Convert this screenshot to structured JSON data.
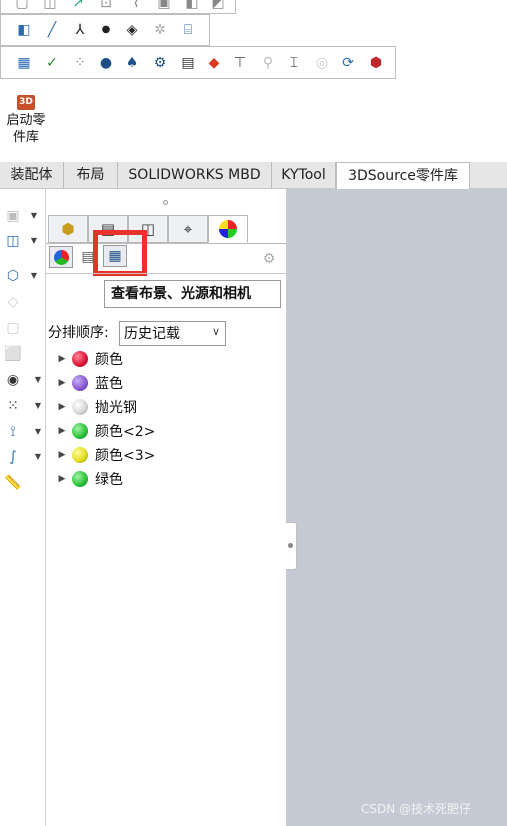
{
  "toolbar": {
    "launch_button_label": "启动零\n件库",
    "launch_icon_text": "3D"
  },
  "tabs": [
    {
      "label": "装配体"
    },
    {
      "label": "布局"
    },
    {
      "label": "SOLIDWORKS MBD"
    },
    {
      "label": "KYTool"
    },
    {
      "label": "3DSource零件库",
      "active": true
    }
  ],
  "panel": {
    "tooltip": "查看布景、光源和相机",
    "sort_label": "分排顺序:",
    "sort_value": "历史记载",
    "tree_items": [
      {
        "label": "颜色",
        "color": "#e0183c"
      },
      {
        "label": "蓝色",
        "color": "#8b5bd6"
      },
      {
        "label": "抛光钢",
        "color": "#d8d8d8"
      },
      {
        "label": "颜色<2>",
        "color": "#2ec63c"
      },
      {
        "label": "颜色<3>",
        "color": "#e3e020"
      },
      {
        "label": "绿色",
        "color": "#2ec63c"
      }
    ]
  },
  "highlight_color": "#e8322c",
  "watermark": "CSDN @技术死肥仔"
}
